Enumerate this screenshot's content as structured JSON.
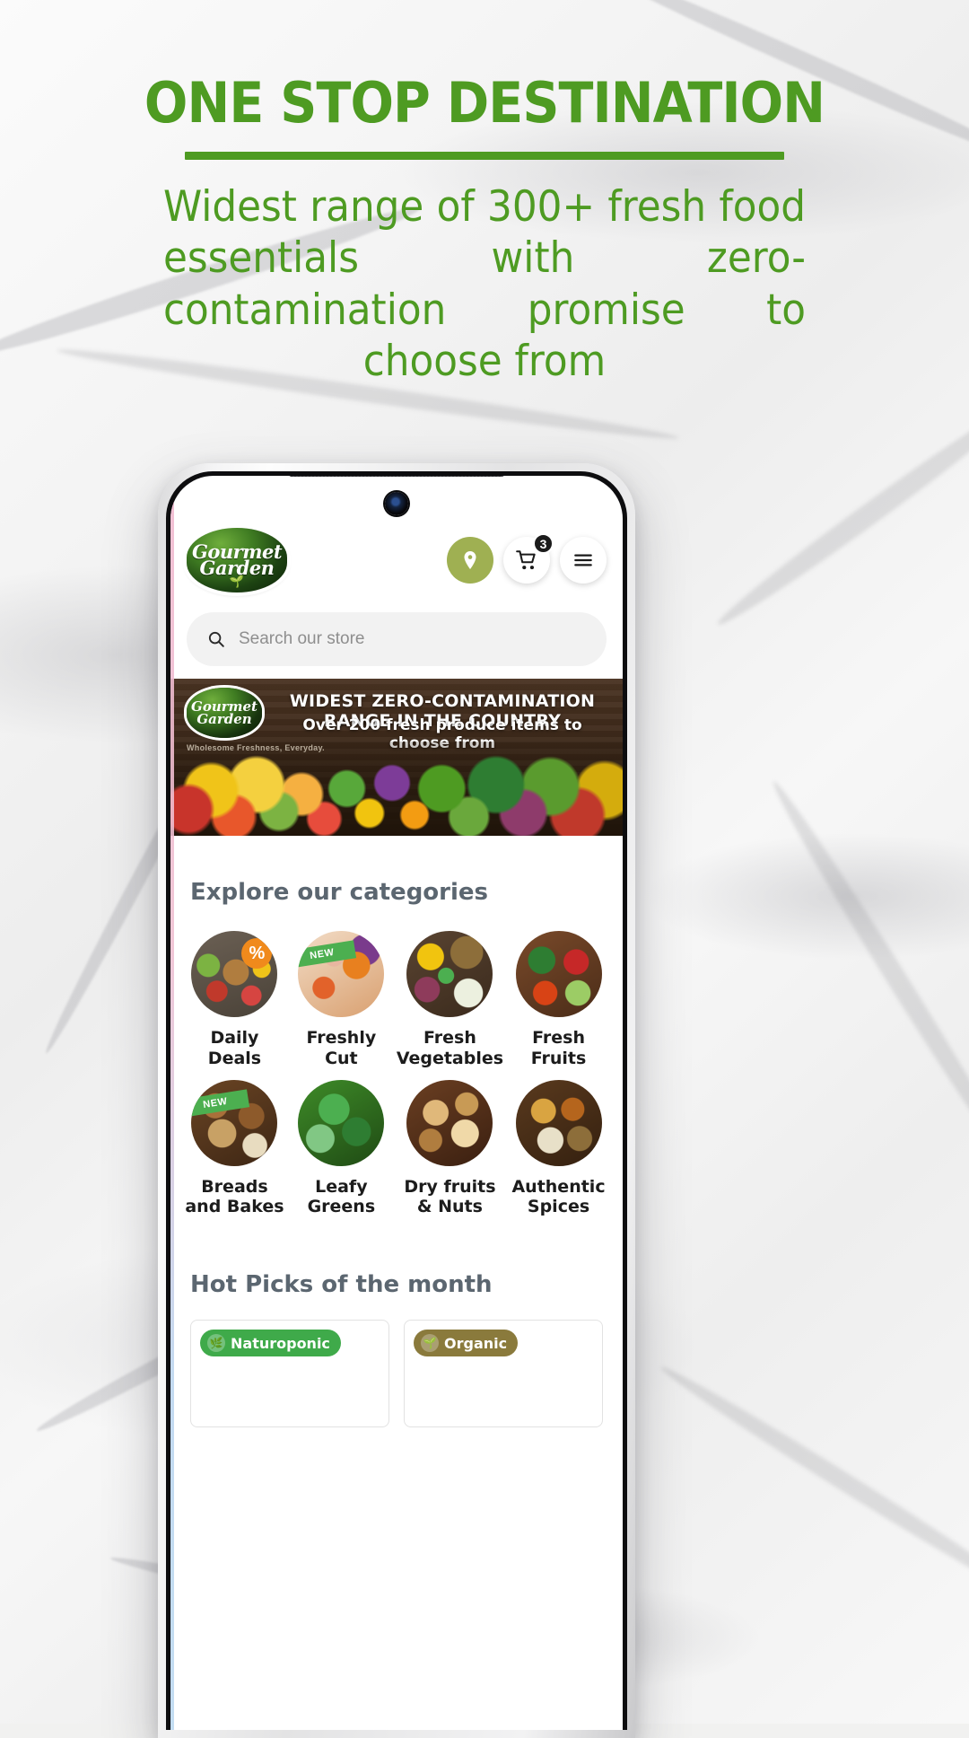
{
  "poster": {
    "headline": "ONE STOP DESTINATION",
    "subheading_lines": [
      "Widest range of 300+ fresh food",
      "essentials with zero-contamination",
      "promise to choose from"
    ],
    "accent_color": "#4e9b22"
  },
  "app": {
    "brand": {
      "line1": "Gourmet",
      "line2": "Garden",
      "sprout_icon": "sprout-icon"
    },
    "header": {
      "location_icon": "location-pin-icon",
      "cart_icon": "shopping-cart-icon",
      "cart_count": "3",
      "menu_icon": "hamburger-menu-icon"
    },
    "search": {
      "placeholder": "Search our store",
      "icon": "search-icon"
    },
    "banner": {
      "logo_line1": "Gourmet",
      "logo_line2": "Garden",
      "tagline": "Wholesome Freshness, Everyday.",
      "title": "WIDEST ZERO-CONTAMINATION RANGE IN THE COUNTRY",
      "subtitle": "Over 200 fresh produce items to choose from"
    },
    "categories_section": {
      "title": "Explore our categories",
      "items": [
        {
          "label": "Daily\nDeals",
          "label_line1": "Daily",
          "label_line2": "Deals",
          "badge": "%",
          "badge_type": "discount",
          "art": "art-deals"
        },
        {
          "label": "Freshly\nCut",
          "label_line1": "Freshly",
          "label_line2": "Cut",
          "badge": "NEW",
          "badge_type": "new",
          "art": "art-cut"
        },
        {
          "label": "Fresh\nVegetables",
          "label_line1": "Fresh",
          "label_line2": "Vegetables",
          "badge": "",
          "badge_type": "none",
          "art": "art-veg"
        },
        {
          "label": "Fresh\nFruits",
          "label_line1": "Fresh",
          "label_line2": "Fruits",
          "badge": "",
          "badge_type": "none",
          "art": "art-fruit"
        },
        {
          "label": "Breads\nand Bakes",
          "label_line1": "Breads",
          "label_line2": "and Bakes",
          "badge": "NEW",
          "badge_type": "new",
          "art": "art-bread"
        },
        {
          "label": "Leafy\nGreens",
          "label_line1": "Leafy",
          "label_line2": "Greens",
          "badge": "",
          "badge_type": "none",
          "art": "art-leafy"
        },
        {
          "label": "Dry fruits\n& Nuts",
          "label_line1": "Dry fruits",
          "label_line2": "& Nuts",
          "badge": "",
          "badge_type": "none",
          "art": "art-dry"
        },
        {
          "label": "Authentic\nSpices",
          "label_line1": "Authentic",
          "label_line2": "Spices",
          "badge": "",
          "badge_type": "none",
          "art": "art-spice"
        }
      ]
    },
    "hot_picks_section": {
      "title": "Hot Picks of the month",
      "cards": [
        {
          "tag_label": "Naturoponic",
          "tag_color": "#3faa4a",
          "tag_icon": "leaf-icon"
        },
        {
          "tag_label": "Organic",
          "tag_color": "#8a7a3c",
          "tag_icon": "sprout-icon"
        }
      ]
    }
  }
}
